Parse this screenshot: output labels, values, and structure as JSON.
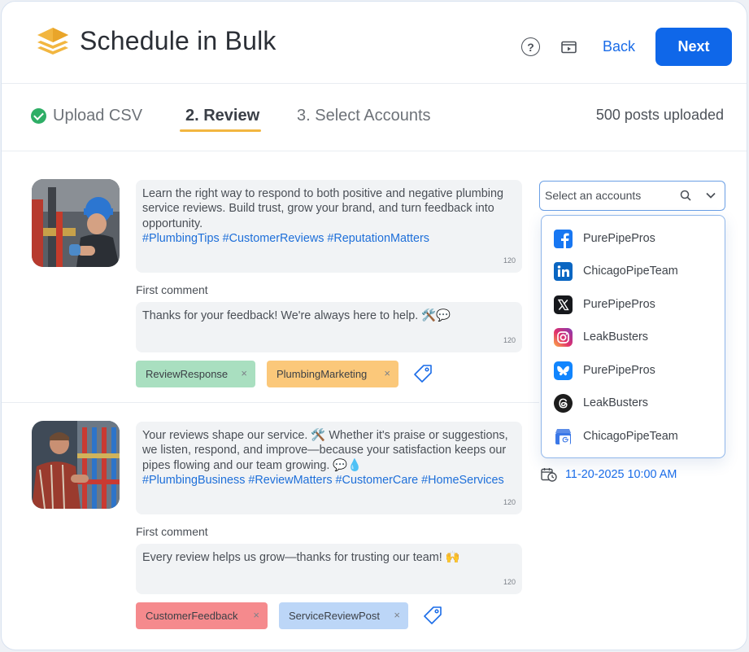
{
  "header": {
    "title": "Schedule in Bulk",
    "help_icon_glyph": "?",
    "back_label": "Back",
    "next_label": "Next",
    "accent": "#0f67e9"
  },
  "steps": {
    "step1": "Upload CSV",
    "step2": "2. Review",
    "step3": "3. Select Accounts",
    "posts_count": "500 posts uploaded"
  },
  "posts": [
    {
      "text": "Learn the right way to respond to both positive and negative plumbing service reviews. Build trust, grow your brand, and turn feedback into opportunity.",
      "hashtags": "#PlumbingTips #CustomerReviews #ReputationMatters",
      "char_count": "120",
      "first_comment_label": "First comment",
      "first_comment": "Thanks for your feedback! We're always here to help. 🛠️💬",
      "first_comment_count": "120",
      "tags": [
        {
          "label": "ReviewResponse",
          "color": "#a9dfc0"
        },
        {
          "label": "PlumbingMarketing",
          "color": "#fbc87a"
        }
      ]
    },
    {
      "text": "Your reviews shape our service. 🛠️ Whether it's praise or suggestions, we listen, respond, and improve—because your satisfaction keeps our pipes flowing and our team growing. 💬💧",
      "hashtags": "#PlumbingBusiness #ReviewMatters #CustomerCare #HomeServices",
      "char_count": "120",
      "first_comment_label": "First comment",
      "first_comment": "Every review helps us grow—thanks for trusting our team! 🙌",
      "first_comment_count": "120",
      "tags": [
        {
          "label": "CustomerFeedback",
          "color": "#f58a8d"
        },
        {
          "label": "ServiceReviewPost",
          "color": "#bcd6f7"
        }
      ]
    }
  ],
  "tag_remove_glyph": "×",
  "account_select": {
    "placeholder": "Select an accounts",
    "accounts": [
      {
        "network": "facebook",
        "icon": "facebook-icon",
        "name": "PurePipePros"
      },
      {
        "network": "linkedin",
        "icon": "linkedin-icon",
        "name": "ChicagoPipeTeam"
      },
      {
        "network": "x",
        "icon": "x-icon",
        "name": "PurePipePros"
      },
      {
        "network": "instagram",
        "icon": "instagram-icon",
        "name": "LeakBusters"
      },
      {
        "network": "bluesky",
        "icon": "bluesky-icon",
        "name": "PurePipePros"
      },
      {
        "network": "threads",
        "icon": "threads-icon",
        "name": "LeakBusters"
      },
      {
        "network": "google-business",
        "icon": "google-business-icon",
        "name": "ChicagoPipeTeam"
      }
    ]
  },
  "schedule": {
    "datetime": "11-20-2025 10:00 AM"
  }
}
